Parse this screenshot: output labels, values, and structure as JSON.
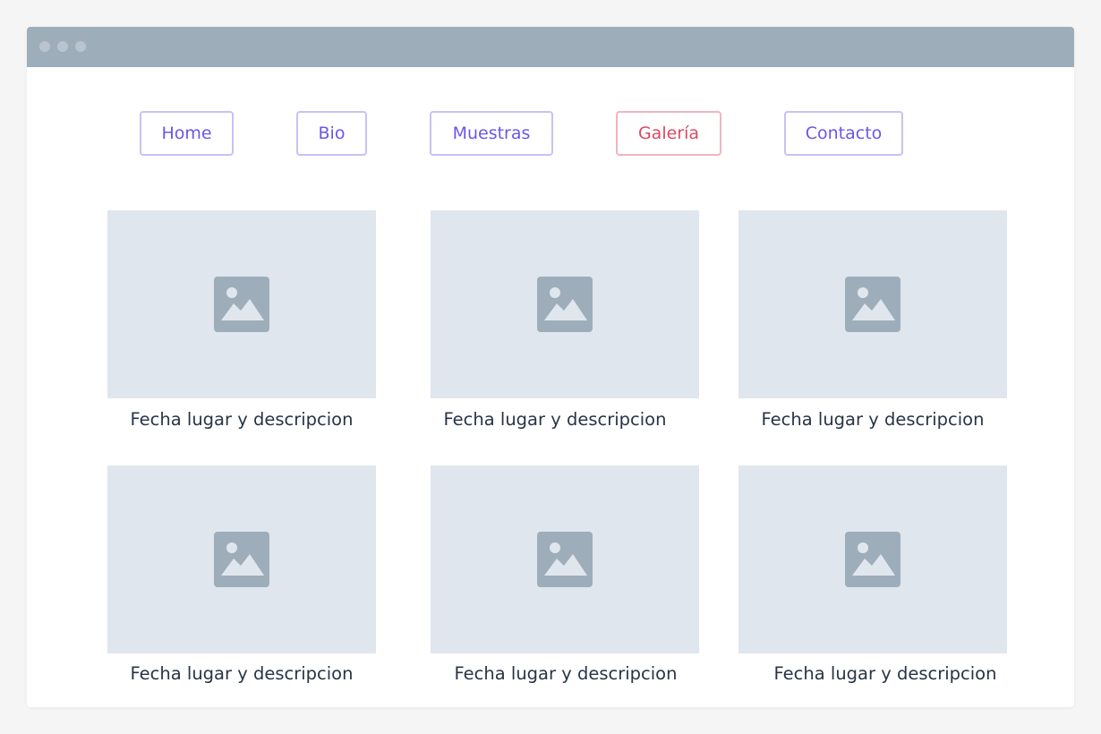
{
  "nav": {
    "items": [
      {
        "label": "Home",
        "active": false
      },
      {
        "label": "Bio",
        "active": false
      },
      {
        "label": "Muestras",
        "active": false
      },
      {
        "label": "Galería",
        "active": true
      },
      {
        "label": "Contacto",
        "active": false
      }
    ]
  },
  "gallery": {
    "items": [
      {
        "caption": "Fecha lugar y descripcion",
        "icon": "image-placeholder-icon"
      },
      {
        "caption": "Fecha lugar y descripcion",
        "icon": "image-placeholder-icon"
      },
      {
        "caption": "Fecha lugar y descripcion",
        "icon": "image-placeholder-icon"
      },
      {
        "caption": "Fecha lugar y descripcion",
        "icon": "image-placeholder-icon"
      },
      {
        "caption": "Fecha lugar y descripcion",
        "icon": "image-placeholder-icon"
      },
      {
        "caption": "Fecha lugar y descripcion",
        "icon": "image-placeholder-icon"
      }
    ]
  },
  "colors": {
    "titlebar": "#9eadba",
    "nav_text": "#6b57e8",
    "nav_border": "#c9c1f2",
    "active_text": "#dc4a60",
    "active_border": "#f0b5bf",
    "image_bg": "#e0e6ee",
    "image_icon": "#9eadba",
    "caption_text": "#283446"
  }
}
